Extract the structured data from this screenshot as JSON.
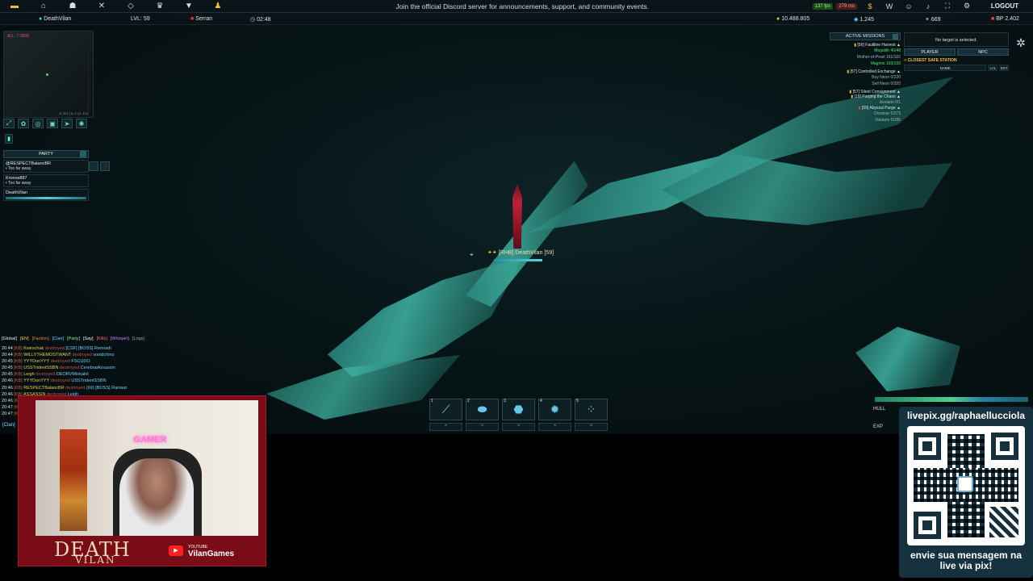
{
  "topbar": {
    "icons": [
      "coins-icon",
      "home-icon",
      "group-icon",
      "swords-icon",
      "diamond-icon",
      "trophy-icon",
      "filter-icon",
      "bell-icon"
    ],
    "announcement": "Join the official Discord server for announcements, support, and community events.",
    "fps": "137 fps",
    "ping": "279 ms",
    "logout": "LOGOUT"
  },
  "infobar": {
    "player": "DeathVilan",
    "level": "LVL: 59",
    "location": "Serran",
    "time": "02:48",
    "credits": "10.488.805",
    "gems": "1.245",
    "shards": "669",
    "bp": "BP 2.402"
  },
  "minimap": {
    "label": "ALL: 7.0008",
    "coords": "0, 207 | 0, 0 | 2, 474"
  },
  "party": {
    "title": "PARTY",
    "members": [
      {
        "name": "@RESPECTBalancBR",
        "status": "• Too far away"
      },
      {
        "name": "Kronos887",
        "status": "• Too far away"
      },
      {
        "name": "DeathVilan",
        "status": ""
      }
    ]
  },
  "missions": {
    "title": "ACTIVE MISSIONS",
    "items": [
      {
        "title": "[56] Faultline Harvest",
        "subs": [
          {
            "t": "Megalith 45/48",
            "green": true
          },
          {
            "t": "Mother-of-Pearl 161/192",
            "green": false
          },
          {
            "t": "Magnox 163/192",
            "green": true
          }
        ]
      },
      {
        "title": "[57] Controlled Exchange",
        "subs": [
          {
            "t": "Buy Neon 0/320",
            "green": false
          },
          {
            "t": "Sell Neon 0/320",
            "green": false
          }
        ]
      },
      {
        "title": "[57] Silent Consignment",
        "subs": []
      },
      {
        "title": "[19] Purging the Chaos",
        "subs": [
          {
            "t": "Azularis 0/1",
            "green": false
          }
        ]
      },
      {
        "title": "[59] Abyssal Purge",
        "subs": [
          {
            "t": "Oceanar 52/73",
            "green": false
          },
          {
            "t": "Voidaris 61/85",
            "green": false
          }
        ]
      }
    ]
  },
  "target": {
    "none": "No target is selected.",
    "tab_player": "PLAYER",
    "tab_npc": "NPC",
    "closest": "CLOSEST SAFE STATION",
    "col_name": "NAME",
    "col_lvl": "LVL",
    "col_dst": "DST"
  },
  "ship": {
    "label": "[RHB] DeathVilan [59]"
  },
  "chat": {
    "tabs": [
      "[Global]",
      "[EN]",
      "[Faction]",
      "[Clan]",
      "[Party]",
      "[Say]",
      "[Kills]",
      "[Whisper]",
      "[Logs]"
    ],
    "tab_colors": [
      "#e8e8e8",
      "#f0d040",
      "#f08040",
      "#70d0ff",
      "#80f080",
      "#f0f0f0",
      "#ff6060",
      "#c080ff",
      "#a0a0a0"
    ],
    "lines": [
      {
        "time": "20:44",
        "tag": "[KB]",
        "a": "Kwirschak",
        "v": "destroyed",
        "b": "[CSF] [BOSS] Remoah"
      },
      {
        "time": "20:44",
        "tag": "[KB]",
        "a": "WILLYTHEMOSTWANT",
        "v": "destroyed",
        "b": "vooidchino"
      },
      {
        "time": "20:45",
        "tag": "[KB]",
        "a": "YYYDonYYY",
        "v": "destroyed",
        "b": "FSCUDO"
      },
      {
        "time": "20:45",
        "tag": "[KB]",
        "a": "USSTridentSSBN",
        "v": "destroyed",
        "b": "CerebraiAssassin"
      },
      {
        "time": "20:45",
        "tag": "[KB]",
        "a": "Leigh",
        "v": "destroyed",
        "b": "DEORVMinkalnl"
      },
      {
        "time": "20:46",
        "tag": "[KB]",
        "a": "YYYDonYYY",
        "v": "destroyed",
        "b": "USSTridentSSBN"
      },
      {
        "time": "20:46",
        "tag": "[KB]",
        "a": "RESPECTBalancBR",
        "v": "destroyed",
        "b": "(69) [BOSS] Ramsat"
      },
      {
        "time": "20:46",
        "tag": "[KB]",
        "a": "ASSASSIN",
        "v": "destroyed",
        "b": "Leigh"
      },
      {
        "time": "20:46",
        "tag": "[KB]",
        "a": "Bussin",
        "v": "destroyed",
        "b": "Deathypen"
      },
      {
        "time": "20:47",
        "tag": "[KB]",
        "a": "Al",
        "v": "",
        "b": ""
      },
      {
        "time": "20:47",
        "tag": "[KB]",
        "a": "U",
        "v": "",
        "b": ""
      }
    ],
    "input_label": "[Clan]"
  },
  "actionbar": {
    "slots": [
      {
        "num": "1",
        "icon": "missile-icon",
        "glyph": "⟋"
      },
      {
        "num": "2",
        "icon": "rocket-icon",
        "glyph": "⬬"
      },
      {
        "num": "3",
        "icon": "capsule-icon",
        "glyph": "⬣"
      },
      {
        "num": "4",
        "icon": "burst-icon",
        "glyph": "✹"
      },
      {
        "num": "5",
        "icon": "swarm-icon",
        "glyph": "⁘"
      }
    ],
    "up_glyph": "⌃"
  },
  "status": {
    "hull": "HULL",
    "exp": "EXP"
  },
  "webcam": {
    "neon": "GAMER",
    "title1": "DEATH",
    "title2": "VILAN",
    "yt_label": "YOUTUBE",
    "yt_name": "VilanGames"
  },
  "qr": {
    "url": "livepix.gg/raphaellucciola",
    "message_l1": "envie sua mensagem na",
    "message_l2": "live via pix!"
  },
  "colors": {
    "accent": "#4fd0e0",
    "gold": "#f0c040",
    "crystal": "#40b6a5"
  }
}
